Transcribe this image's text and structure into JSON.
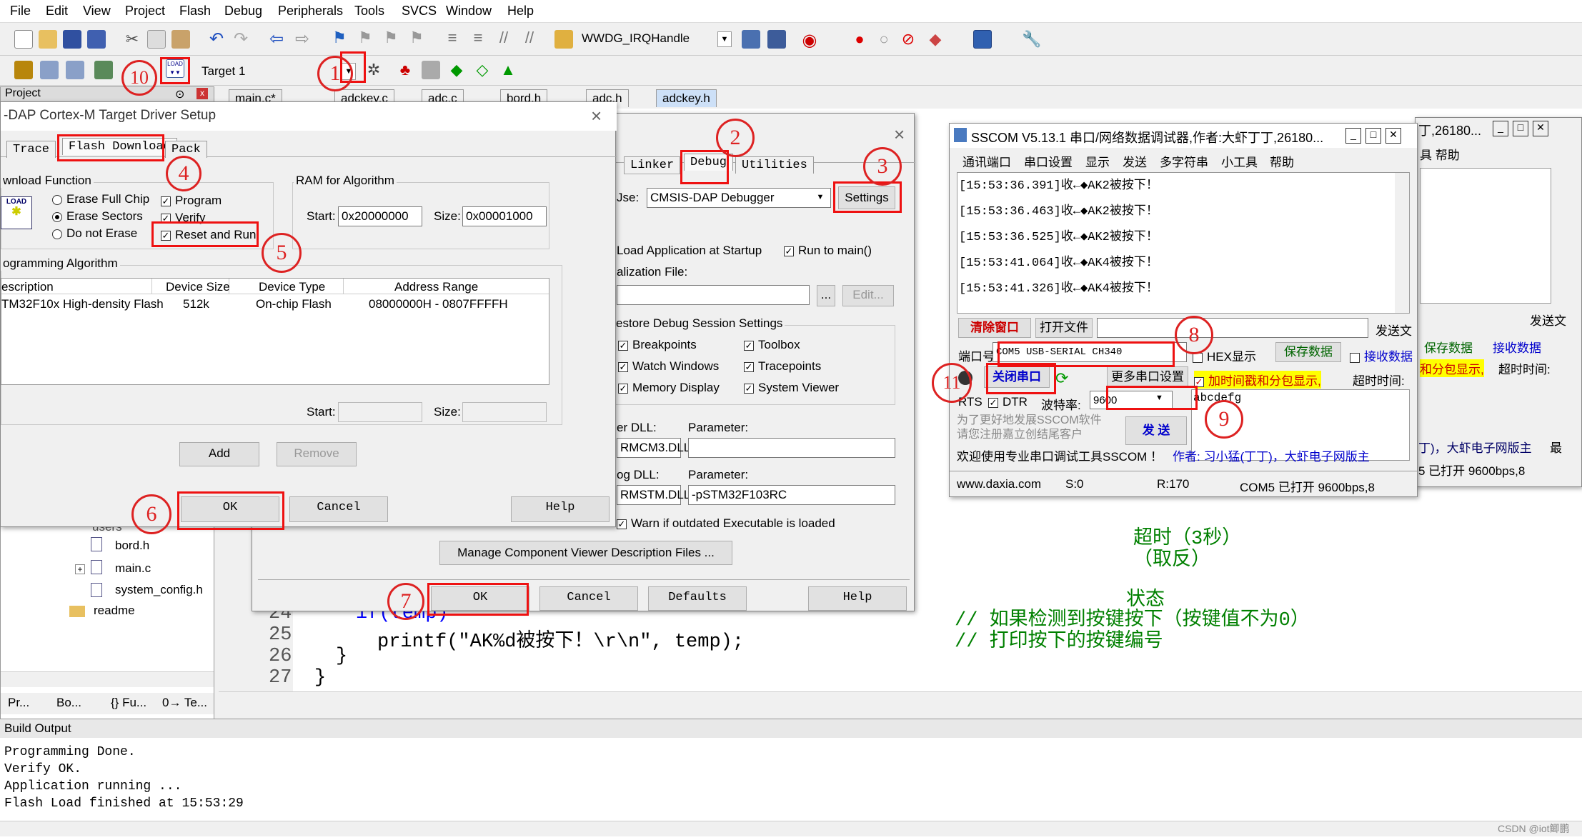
{
  "menu": [
    "File",
    "Edit",
    "View",
    "Project",
    "Flash",
    "Debug",
    "Peripherals",
    "Tools",
    "SVCS",
    "Window",
    "Help"
  ],
  "toolbar": {
    "function_combo": "WWDG_IRQHandle",
    "target": "Target 1"
  },
  "project_panel": {
    "title": "Project",
    "pin": "⊙",
    "close": "x",
    "tree": [
      "bord.h",
      "main.c",
      "system_config.h",
      "readme"
    ],
    "users_partial": "users",
    "bottom_tabs": [
      "Pr...",
      "Bo...",
      "{} Fu...",
      "0→ Te..."
    ]
  },
  "editor_tabs": [
    "main.c*",
    "adckey.c",
    "adc.c",
    "bord.h",
    "adc.h",
    "adckey.h"
  ],
  "code": {
    "lines": [
      {
        "n": "24",
        "text": "if(temp)",
        "comment": "// 如果检测到按键按下（按键值不为0）"
      },
      {
        "n": "25",
        "text": "printf(\"AK%d被按下！\\r\\n\", temp);",
        "comment": "// 打印按下的按键编号"
      },
      {
        "n": "26",
        "text": "}"
      },
      {
        "n": "27",
        "text": "}"
      }
    ],
    "frag1": "超时（3秒）",
    "frag2": "（取反）",
    "frag3": "状态",
    "stars1": "**",
    "stars2": "**",
    "frag4": "0("
  },
  "flash_dialog": {
    "title": "-DAP Cortex-M Target Driver Setup",
    "close": "×",
    "tabs": [
      "Trace",
      "Flash Download",
      "Pack"
    ],
    "download_function": {
      "label": "wnload Function",
      "load_icon": "LOAD",
      "radios": [
        "Erase Full Chip",
        "Erase Sectors",
        "Do not Erase"
      ],
      "selected": "Erase Sectors",
      "checks": [
        "Program",
        "Verify",
        "Reset and Run"
      ]
    },
    "ram": {
      "label": "RAM for Algorithm",
      "start_label": "Start:",
      "start": "0x20000000",
      "size_label": "Size:",
      "size": "0x00001000"
    },
    "algorithm": {
      "label": "ogramming Algorithm",
      "columns": [
        "escription",
        "Device Size",
        "Device Type",
        "Address Range"
      ],
      "rows": [
        [
          "TM32F10x High-density Flash",
          "512k",
          "On-chip Flash",
          "08000000H - 0807FFFFH"
        ]
      ],
      "start_label": "Start:",
      "size_label": "Size:"
    },
    "buttons": {
      "add": "Add",
      "remove": "Remove",
      "ok": "OK",
      "cancel": "Cancel",
      "help": "Help"
    }
  },
  "options_dialog": {
    "close": "×",
    "tabs": [
      "Linker",
      "Debug",
      "Utilities"
    ],
    "use_label": "Jse:",
    "debugger": "CMSIS-DAP Debugger",
    "settings": "Settings",
    "load_app": "Load Application at Startup",
    "run_main": "Run to main()",
    "init_file": "alization File:",
    "browse": "...",
    "edit": "Edit...",
    "restore": "estore Debug Session Settings",
    "restore_checks": [
      "Breakpoints",
      "Toolbox",
      "Watch Windows",
      "Tracepoints",
      "Memory Display",
      "System Viewer"
    ],
    "cpu_dll_label": "er DLL:",
    "cpu_dll": "RMCM3.DLL",
    "param_label": "Parameter:",
    "cpu_param": "",
    "dialog_dll_label": "og DLL:",
    "dialog_dll": "RMSTM.DLL",
    "dialog_param": "-pSTM32F103RC",
    "warn": "Warn if outdated Executable is loaded",
    "manage": "Manage Component Viewer Description Files ...",
    "ok": "OK",
    "cancel": "Cancel",
    "defaults": "Defaults",
    "help": "Help"
  },
  "sscom": {
    "title": "SSCOM V5.13.1 串口/网络数据调试器,作者:大虾丁丁,26180...",
    "menu": [
      "通讯端口",
      "串口设置",
      "显示",
      "发送",
      "多字符串",
      "小工具",
      "帮助"
    ],
    "log": [
      "[15:53:36.391]收←◆AK2被按下！",
      "[15:53:36.463]收←◆AK2被按下！",
      "[15:53:36.525]收←◆AK2被按下！",
      "[15:53:41.064]收←◆AK4被按下！",
      "[15:53:41.326]收←◆AK4被按下！"
    ],
    "clear": "清除窗口",
    "open_file": "打开文件",
    "send_file": "发送文",
    "port_label": "端口号",
    "port": "COM5 USB-SERIAL CH340",
    "hex_display": "HEX显示",
    "save_data": "保存数据",
    "recv_to": "接收数据",
    "close_port": "关闭串口",
    "more_settings": "更多串口设置",
    "timestamp": "加时间戳和分包显示,",
    "timeout": "超时时间:",
    "rts": "RTS",
    "dtr": "DTR",
    "baud_label": "波特率:",
    "baud": "9600",
    "send_text": "abcdefg",
    "ad": "为了更好地发展SSCOM软件\n请您注册嘉立创结尾客户",
    "send": "发 送",
    "welcome": "欢迎使用专业串口调试工具SSCOM ！",
    "author": "作者: 习小猛(丁丁)，大虾电子网版主",
    "status": [
      "www.daxia.com",
      "S:0",
      "R:170",
      "COM5 已打开  9600bps,8"
    ]
  },
  "sscom_back": {
    "title": "丁,26180...",
    "menu": "具  帮助",
    "send_file": "发送文",
    "save": "保存数据",
    "recv": "接收数据",
    "timestamp": "和分包显示,",
    "timeout": "超时时间:",
    "author": "丁)，大虾电子网版主",
    "end": "最",
    "status": "5 已打开  9600bps,8"
  },
  "build_output": {
    "title": "Build Output",
    "lines": [
      "Programming Done.",
      "Verify OK.",
      "Application running ...",
      "Flash Load finished at 15:53:29"
    ]
  },
  "annotations": [
    "1",
    "2",
    "3",
    "4",
    "5",
    "6",
    "7",
    "8",
    "9",
    "10",
    "11"
  ],
  "watermark": "CSDN @iot鲫鹏",
  "colors": {
    "annotation": "#dd2222",
    "keyword": "#0000ff",
    "comment": "#008000",
    "string": "#800080"
  }
}
